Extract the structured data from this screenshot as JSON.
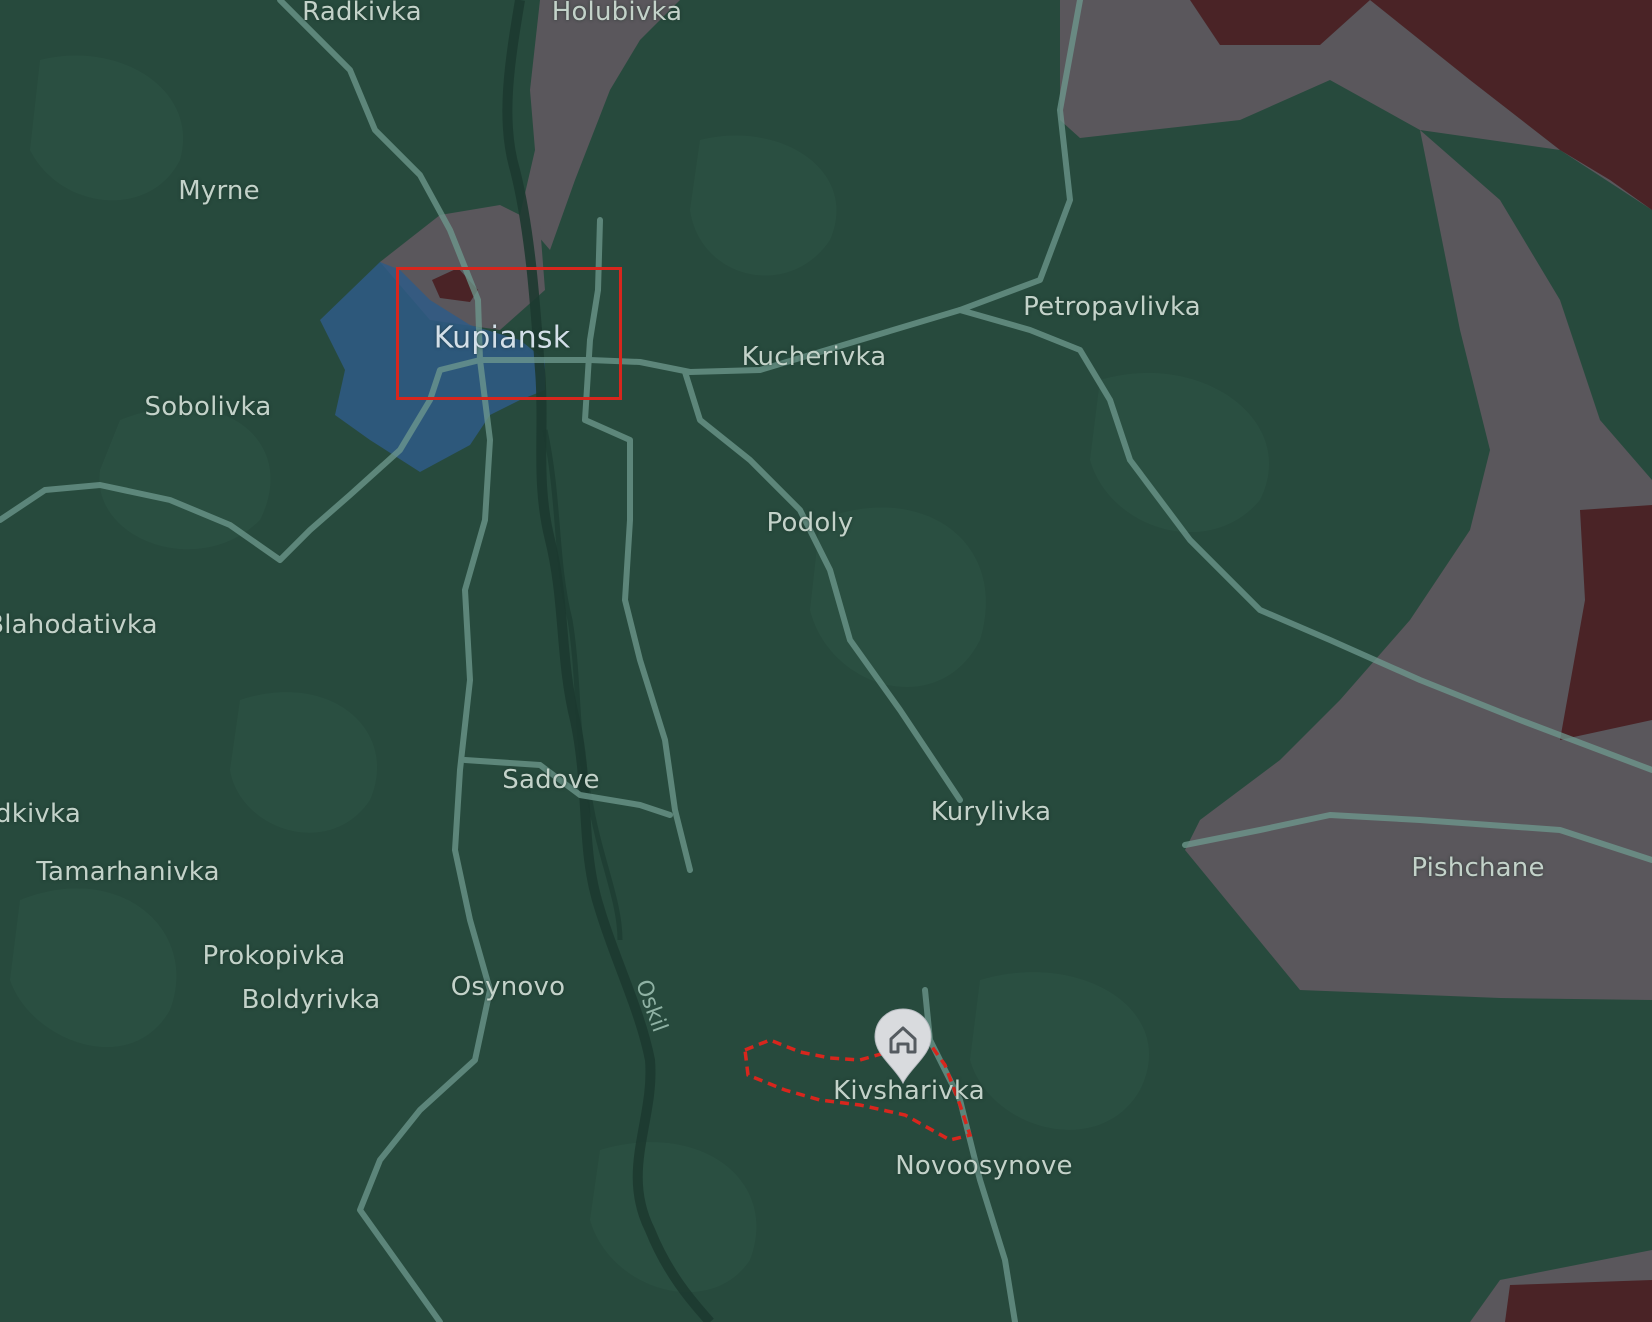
{
  "map": {
    "colors": {
      "controlled_area": "#274a3d",
      "contested_area": "#5a575c",
      "occupied_area": "#4a2326",
      "liberated_area": "#2f5a86",
      "roads": "#6f9a8f",
      "river": "#1d3a30",
      "focus_box": "#d8261d",
      "boundary_dashed": "#d8261d",
      "label_text": "#c3d2c9"
    },
    "focus_area_label": "Kupiansk",
    "river_label": "Oskil",
    "marker_icon": "home-icon",
    "places": [
      {
        "id": "radkivka",
        "name": "Radkivka"
      },
      {
        "id": "holubivka",
        "name": "Holubivka"
      },
      {
        "id": "myrne",
        "name": "Myrne"
      },
      {
        "id": "kupiansk",
        "name": "Kupiansk"
      },
      {
        "id": "petropavlivka",
        "name": "Petropavlivka"
      },
      {
        "id": "kucherivka",
        "name": "Kucherivka"
      },
      {
        "id": "sobolivka",
        "name": "Sobolivka"
      },
      {
        "id": "podoly",
        "name": "Podoly"
      },
      {
        "id": "blahodativka",
        "name": "Blahodativka"
      },
      {
        "id": "sadove",
        "name": "Sadove"
      },
      {
        "id": "dkivka",
        "name": "dkivka"
      },
      {
        "id": "kurylivka",
        "name": "Kurylivka"
      },
      {
        "id": "tamarhanivka",
        "name": "Tamarhanivka"
      },
      {
        "id": "pishchane",
        "name": "Pishchane"
      },
      {
        "id": "prokopivka",
        "name": "Prokopivka"
      },
      {
        "id": "osynovo",
        "name": "Osynovo"
      },
      {
        "id": "boldyrivka",
        "name": "Boldyrivka"
      },
      {
        "id": "kivsharivka",
        "name": "Kivsharivka"
      },
      {
        "id": "novoosynove",
        "name": "Novoosynove"
      }
    ]
  }
}
